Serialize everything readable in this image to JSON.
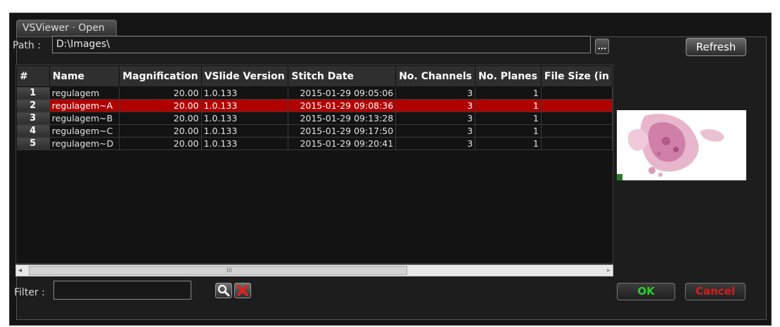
{
  "window": {
    "title": "VSViewer · Open"
  },
  "path": {
    "label": "Path :",
    "value": "D:\\Images\\",
    "browse_label": "..."
  },
  "toolbar": {
    "refresh_label": "Refresh"
  },
  "table": {
    "columns": [
      "#",
      "Name",
      "Magnification",
      "VSlide Version",
      "Stitch Date",
      "No. Channels",
      "No. Planes",
      "File Size (in"
    ],
    "rows": [
      {
        "index": "1",
        "name": "regulagem",
        "magnification": "20.00",
        "version": "1.0.133",
        "stitch_date": "2015-01-29 09:05:06",
        "channels": "3",
        "planes": "1",
        "size": ""
      },
      {
        "index": "2",
        "name": "regulagem~A",
        "magnification": "20.00",
        "version": "1.0.133",
        "stitch_date": "2015-01-29 09:08:36",
        "channels": "3",
        "planes": "1",
        "size": ""
      },
      {
        "index": "3",
        "name": "regulagem~B",
        "magnification": "20.00",
        "version": "1.0.133",
        "stitch_date": "2015-01-29 09:13:28",
        "channels": "3",
        "planes": "1",
        "size": ""
      },
      {
        "index": "4",
        "name": "regulagem~C",
        "magnification": "20.00",
        "version": "1.0.133",
        "stitch_date": "2015-01-29 09:17:50",
        "channels": "3",
        "planes": "1",
        "size": ""
      },
      {
        "index": "5",
        "name": "regulagem~D",
        "magnification": "20.00",
        "version": "1.0.133",
        "stitch_date": "2015-01-29 09:20:41",
        "channels": "3",
        "planes": "1",
        "size": ""
      }
    ],
    "selected_index": 1,
    "selected_color": "#b10000"
  },
  "scrollbar": {
    "left_arrow": "◂",
    "right_arrow": "▸",
    "grip": "III"
  },
  "filter": {
    "label": "Filter :",
    "value": "",
    "search_icon": "search-icon",
    "clear_icon": "clear-filter-icon"
  },
  "footer": {
    "ok_label": "OK",
    "cancel_label": "Cancel",
    "ok_color": "#2bd12b",
    "cancel_color": "#d41c1c"
  },
  "preview": {
    "icon": "slide-thumbnail"
  }
}
